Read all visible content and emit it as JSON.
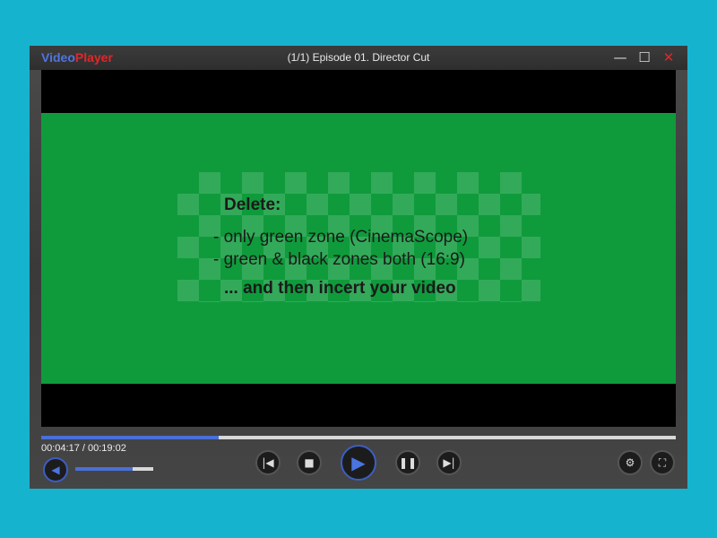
{
  "app": {
    "logo_first": "Video",
    "logo_second": "Player",
    "title": "(1/1) Episode 01. Director Cut"
  },
  "window_controls": {
    "minimize": "—",
    "maximize": "☐",
    "close": "✕"
  },
  "overlay": {
    "heading": "Delete:",
    "line1": "- only green zone (CinemaScope)",
    "line2": "- green & black zones both (16:9)",
    "line3": "... and then incert your video"
  },
  "player": {
    "time": "00:04:17 / 00:19:02",
    "progress": 0.28,
    "volume": 0.74
  },
  "colors": {
    "accent": "#4a6fd8",
    "green": "#0f9b3c",
    "background": "#16b3cf"
  }
}
